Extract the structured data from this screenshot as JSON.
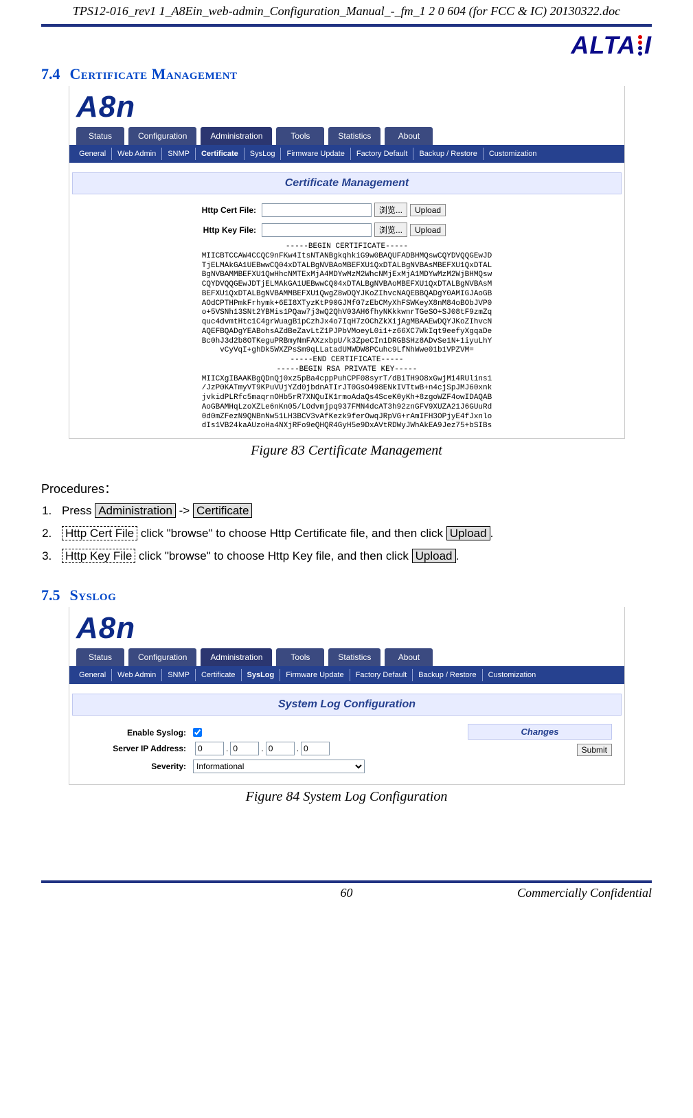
{
  "doc_title": "TPS12-016_rev1 1_A8Ein_web-admin_Configuration_Manual_-_fm_1 2 0 604 (for FCC & IC) 20130322.doc",
  "logo_text": "ALTAI",
  "section_74_num": "7.4",
  "section_74_title": "Certificate Management",
  "section_75_num": "7.5",
  "section_75_title": "Syslog",
  "product_logo": "A8n",
  "topnav": [
    "Status",
    "Configuration",
    "Administration",
    "Tools",
    "Statistics",
    "About"
  ],
  "subnav": [
    "General",
    "Web Admin",
    "SNMP",
    "Certificate",
    "SysLog",
    "Firmware Update",
    "Factory Default",
    "Backup / Restore",
    "Customization"
  ],
  "cert": {
    "panel_title": "Certificate Management",
    "row1_label": "Http Cert File:",
    "row2_label": "Http Key File:",
    "browse_label": "浏览...",
    "upload_label": "Upload",
    "block": "-----BEGIN CERTIFICATE-----\nMIICBTCCAW4CCQC9nFKw4ItsNTANBgkqhkiG9w0BAQUFADBHMQswCQYDVQQGEwJD\nTjELMAkGA1UEBwwCQ04xDTALBgNVBAoMBEFXU1QxDTALBgNVBAsMBEFXU1QxDTAL\nBgNVBAMMBEFXU1QwHhcNMTExMjA4MDYwMzM2WhcNMjExMjA1MDYwMzM2WjBHMQsw\nCQYDVQQGEwJDTjELMAkGA1UEBwwCQ04xDTALBgNVBAoMBEFXU1QxDTALBgNVBAsM\nBEFXU1QxDTALBgNVBAMMBEFXU1QwgZ8wDQYJKoZIhvcNAQEBBQADgY0AMIGJAoGB\nAOdCPTHPmkFrhymk+6EI8XTyzKtP90GJMf07zEbCMyXhFSWKeyX8nM84oBObJVP0\no+5VSNh13SNt2YBMis1PQaw7j3wQ2QhV03AH6fhyNKkkwnrTGeSO+SJ08tF9zmZq\nquc4dvmtHtc1C4grWuagB1pCzhJx4o7IqH7zOChZkXijAgMBAAEwDQYJKoZIhvcN\nAQEFBQADgYEABohsAZdBeZavLtZ1PJPbVMoeyL0i1+z66XC7WkIqt9eefyXgqaDe\nBc0hJ3d2b8OTKeguPRBmyNmFAXzxbpU/k3ZpeCIn1DRGBSHz8ADvSe1N+1iyuLhY\nvCyVqI+ghDk5WXZPsSm9qLLatadUMWDW8PCuhc9LfNhWwe01b1VPZVM=\n-----END CERTIFICATE-----\n-----BEGIN RSA PRIVATE KEY-----\nMIICXgIBAAKBgQDnQj0xz5pBa4cppPuhCPF08syrT/dBiTH9O8xGwjM14RUlins1\n/JzP0KATmyVT9KPuVUjYZd0jbdnATIrJT0GsO498ENkIVTtwB+n4cjSpJMJ60xnk\njvkidPLRfc5maqrnOHb5rR7XNQuIK1rmoAdaQs4SceK0yKh+8zgoWZF4owIDAQAB\nAoGBAMHqLzoXZLe6nKn05/LOdvmjpq937FMN4dcAT3h92znGFV9XUZA21J6GUuRd\n0d0mZFezN9QNBnNw51LH3BCV3vAfKezk9ferOwqJRpVG+rAmIFH3OPjyE4fJxnlo\ndIs1VB24kaAUzoHa4NXjRFo9eQHQR4GyH5e9DxAVtRDWyJWhAkEA9Jez75+bSIBs"
  },
  "fig83": "Figure 83 Certificate Management",
  "procedures_heading": "Procedures：",
  "proc1_a": "Press ",
  "proc1_admin": "Administration",
  "proc1_arrow": " -> ",
  "proc1_cert": "Certificate",
  "proc2_key": "Http Cert File",
  "proc2_text": " click \"browse\" to choose Http Certificate file, and then click ",
  "proc2_upload": "Upload",
  "proc3_key": "Http Key File",
  "proc3_text": " click \"browse\" to choose Http Key file, and then click ",
  "proc3_upload": "Upload",
  "syslog": {
    "panel_title": "System Log Configuration",
    "enable_label": "Enable Syslog:",
    "ip_label": "Server IP Address:",
    "sev_label": "Severity:",
    "ip_parts": [
      "0",
      "0",
      "0",
      "0"
    ],
    "sev_value": "Informational",
    "changes_title": "Changes",
    "submit_label": "Submit"
  },
  "fig84": "Figure 84 System Log Configuration",
  "footer_page": "60",
  "footer_conf": "Commercially Confidential"
}
